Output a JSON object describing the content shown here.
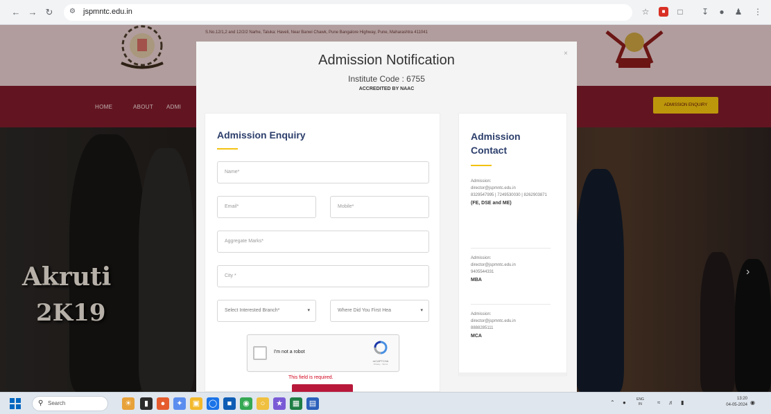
{
  "browser": {
    "url": "jspmntc.edu.in",
    "icons": [
      "back-icon",
      "forward-icon",
      "reload-icon",
      "site-info-icon",
      "star-icon",
      "extension-icon",
      "puzzle-icon",
      "download-icon",
      "profile-icon",
      "menu-icon"
    ]
  },
  "site": {
    "address": "S.No.12/1,2 and 12/2/2 Narhe, Taluka: Haveli, Near Banwi Chawk, Pune Bangalore Highway, Pune, Maharashtra 411041",
    "nav": {
      "home": "HOME",
      "about": "ABOUT",
      "admissions": "ADMI",
      "enquiry_button": "ADMISSION ENQUIRY"
    },
    "hero": {
      "line1": "Akruti",
      "line2": "2K19",
      "next_icon": "chevron-right-icon"
    }
  },
  "modal": {
    "close_symbol": "×",
    "title": "Admission Notification",
    "institute_code": "Institute Code : 6755",
    "accreditation": "ACCREDITED BY NAAC",
    "form": {
      "heading": "Admission Enquiry",
      "name_placeholder": "Name*",
      "email_placeholder": "Email*",
      "mobile_placeholder": "Mobile*",
      "marks_placeholder": "Aggregate Marks*",
      "city_placeholder": "City *",
      "branch_select": "Select Interested Branch*",
      "source_select": "Where Did You First Hea",
      "captcha_label": "I'm not a robot",
      "captcha_brand": "reCAPTCHA",
      "captcha_terms": "Privacy - Terms",
      "error": "This field is required."
    },
    "contact": {
      "heading": "Admission Contact",
      "blocks": [
        {
          "label": "Admission:",
          "email": "director@jspmntc.edu.in",
          "phones": "8329547995 | 7249530030 | 8262903871",
          "category": "(FE, DSE and ME)"
        },
        {
          "label": "Admission:",
          "email": "director@jspmntc.edu.in",
          "phones": "9405544331",
          "category": "MBA"
        },
        {
          "label": "Admission:",
          "email": "director@jspmntc.edu.in",
          "phones": "8888285111",
          "category": "MCA"
        }
      ]
    }
  },
  "taskbar": {
    "search_label": "Search",
    "lang": "ENG",
    "lang_region": "IN",
    "time": "13:20",
    "date": "04-05-2024"
  },
  "colors": {
    "nav_maroon": "#7e1b2b",
    "enquiry_yellow": "#f2c20f",
    "heading_blue": "#2c3e6b",
    "error_red": "#d0021b",
    "submit_red": "#b8193a"
  }
}
